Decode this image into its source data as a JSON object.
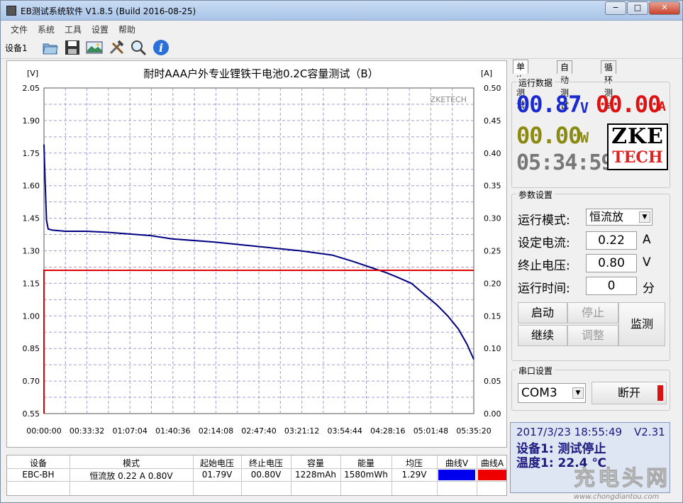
{
  "window": {
    "title": "EB测试系统软件 V1.8.5 (Build 2016-08-25)",
    "minimize": "−",
    "maximize": "□",
    "close": "✕"
  },
  "menu": [
    "文件",
    "系统",
    "工具",
    "设置",
    "帮助"
  ],
  "toolbar": {
    "device_tab": "设备1",
    "icons": [
      "open-folder-icon",
      "save-icon",
      "chart-image-icon",
      "tools-icon",
      "search-icon",
      "info-icon"
    ]
  },
  "chart": {
    "title": "耐时AAA户外专业锂铁干电池0.2C容量测试（B）",
    "watermark": "ZKETECH",
    "left_unit": "[V]",
    "right_unit": "[A]"
  },
  "chart_data": {
    "type": "line",
    "x_ticks": [
      "00:00:00",
      "00:33:32",
      "01:07:04",
      "01:40:36",
      "02:14:08",
      "02:47:40",
      "03:21:12",
      "03:54:44",
      "04:28:16",
      "05:01:48",
      "05:35:20"
    ],
    "y_left_ticks": [
      "2.05",
      "1.90",
      "1.75",
      "1.60",
      "1.45",
      "1.30",
      "1.15",
      "1.00",
      "0.85",
      "0.70",
      "0.55"
    ],
    "y_right_ticks": [
      "0.50",
      "0.45",
      "0.40",
      "0.35",
      "0.30",
      "0.25",
      "0.20",
      "0.15",
      "0.10",
      "0.05",
      "0.00"
    ],
    "xlim_seconds": [
      0,
      20120
    ],
    "ylim_left": [
      0.55,
      2.05
    ],
    "ylim_right": [
      0.0,
      0.5
    ],
    "series": [
      {
        "name": "曲线V",
        "axis": "left",
        "color": "#000080",
        "x_seconds": [
          0,
          60,
          120,
          200,
          400,
          1000,
          2000,
          3000,
          5000,
          6000,
          8000,
          10000,
          12000,
          13500,
          14500,
          15400,
          16000,
          16500,
          17200,
          17800,
          18400,
          18900,
          19400,
          19800,
          20120
        ],
        "y": [
          1.79,
          1.6,
          1.44,
          1.4,
          1.395,
          1.39,
          1.39,
          1.385,
          1.37,
          1.355,
          1.34,
          1.32,
          1.3,
          1.28,
          1.25,
          1.22,
          1.2,
          1.18,
          1.15,
          1.1,
          1.05,
          1.0,
          0.94,
          0.87,
          0.8
        ]
      },
      {
        "name": "曲线A",
        "axis": "right",
        "color": "#dd0000",
        "x_seconds": [
          0,
          0,
          20120
        ],
        "y": [
          0.0,
          0.22,
          0.22
        ]
      }
    ]
  },
  "tabs": [
    "单次测试",
    "自动测试",
    "循环测试"
  ],
  "run_data": {
    "label": "运行数据",
    "voltage": "00.87",
    "voltage_unit": "V",
    "current": "00.00",
    "current_unit": "A",
    "power": "00.00",
    "power_unit": "W",
    "time": "05:34:59",
    "logo_top": "ZKE",
    "logo_bottom": "TECH"
  },
  "params": {
    "label": "参数设置",
    "mode_label": "运行模式:",
    "mode_value": "恒流放",
    "current_label": "设定电流:",
    "current_value": "0.22",
    "current_unit": "A",
    "cutoff_label": "终止电压:",
    "cutoff_value": "0.80",
    "cutoff_unit": "V",
    "runtime_label": "运行时间:",
    "runtime_value": "0",
    "runtime_unit": "分"
  },
  "controls": {
    "start": "启动",
    "stop": "停止",
    "continue": "继续",
    "adjust": "调整",
    "monitor": "监测"
  },
  "serial": {
    "label": "串口设置",
    "port": "COM3",
    "disconnect": "断开"
  },
  "status": {
    "datetime": "2017/3/23 18:55:49",
    "version": "V2.31",
    "device_status": "设备1: 测试停止",
    "temperature": "温度1: 22.4 ℃"
  },
  "table": {
    "headers": [
      "设备",
      "模式",
      "起始电压",
      "终止电压",
      "容量",
      "能量",
      "均压",
      "曲线V",
      "曲线A"
    ],
    "row": [
      "EBC-BH",
      "恒流放  0.22 A  0.80V",
      "01.79V",
      "00.80V",
      "1228mAh",
      "1580mWh",
      "1.29V"
    ],
    "swatch_v": "#0000ee",
    "swatch_a": "#ee0000"
  },
  "watermark": {
    "text": "充电头网",
    "url": "www.chongdiantou.com"
  }
}
